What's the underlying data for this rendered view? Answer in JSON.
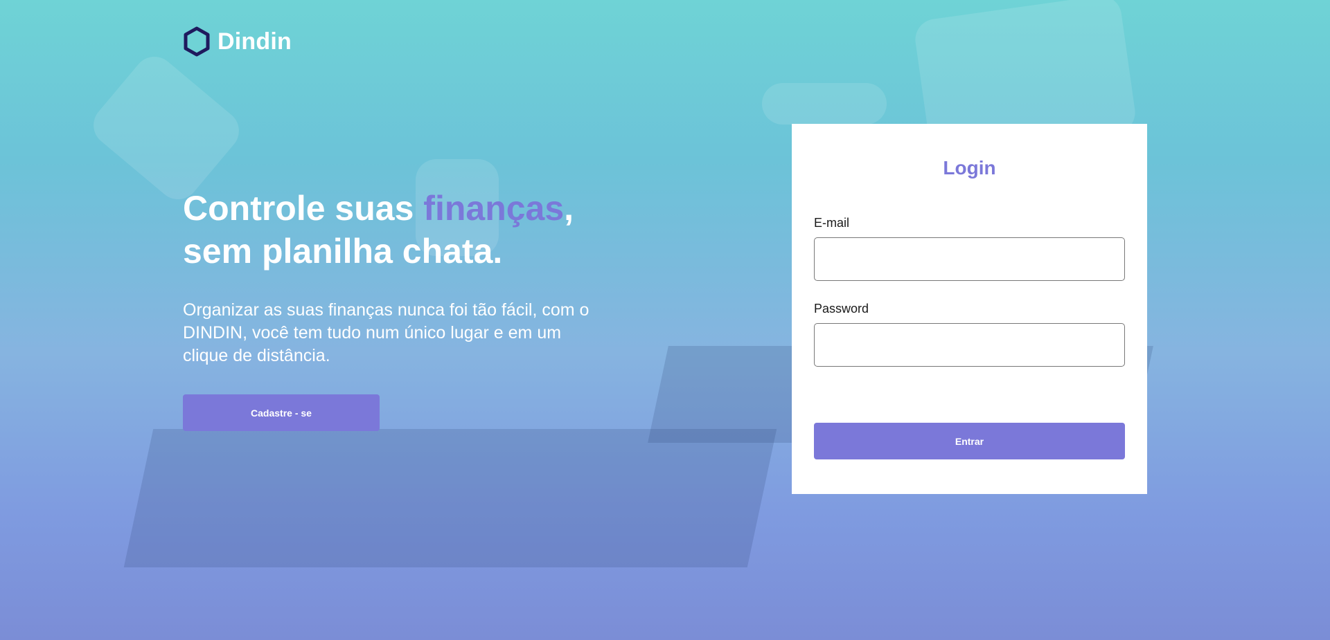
{
  "brand": {
    "name": "Dindin",
    "icon": "hexagon-logo-icon"
  },
  "hero": {
    "headline_part1": "Controle suas ",
    "headline_accent": "finanças",
    "headline_part2": ",",
    "headline_line2": "sem planilha chata.",
    "subtext": "Organizar as suas finanças nunca foi tão fácil, com o DINDIN, você tem tudo num único lugar e em um clique de distância."
  },
  "signup_button": {
    "label": "Cadastre - se"
  },
  "login_card": {
    "title": "Login",
    "email_label": "E-mail",
    "email_value": "",
    "password_label": "Password",
    "password_value": "",
    "submit_label": "Entrar"
  },
  "colors": {
    "accent": "#7b78d9",
    "logo_outline": "#1f1a5e",
    "logo_fill": "#6fd3d6"
  }
}
